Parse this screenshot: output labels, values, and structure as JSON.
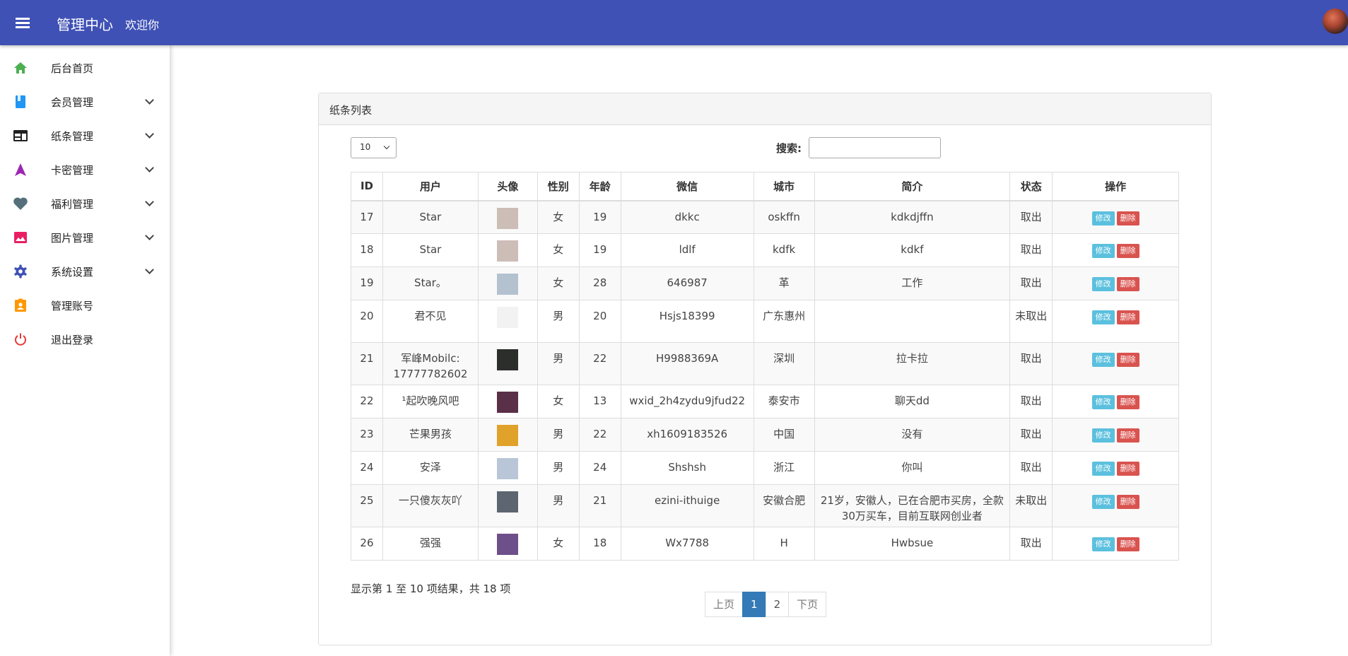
{
  "header": {
    "title": "管理中心",
    "welcome": "欢迎你"
  },
  "sidebar": {
    "items": [
      {
        "label": "后台首页",
        "icon": "home-icon",
        "color": "#4caf50"
      },
      {
        "label": "会员管理",
        "icon": "book-icon",
        "color": "#2196f3"
      },
      {
        "label": "纸条管理",
        "icon": "web-icon",
        "color": "#212121"
      },
      {
        "label": "卡密管理",
        "icon": "navigation-icon",
        "color": "#9c27b0"
      },
      {
        "label": "福利管理",
        "icon": "heart-icon",
        "color": "#546e7a"
      },
      {
        "label": "图片管理",
        "icon": "image-icon",
        "color": "#e91e63"
      },
      {
        "label": "系统设置",
        "icon": "gear-icon",
        "color": "#3f51b5"
      },
      {
        "label": "管理账号",
        "icon": "account-badge-icon",
        "color": "#ff9800"
      },
      {
        "label": "退出登录",
        "icon": "power-icon",
        "color": "#e53935"
      }
    ]
  },
  "panel": {
    "title": "纸条列表"
  },
  "controls": {
    "page_length": "10",
    "search_label": "搜索:"
  },
  "table": {
    "headers": [
      "ID",
      "用户",
      "头像",
      "性别",
      "年龄",
      "微信",
      "城市",
      "简介",
      "状态",
      "操作"
    ],
    "edit_label": "修改",
    "delete_label": "删除",
    "rows": [
      {
        "id": "17",
        "user": "Star",
        "avatar": "#cdbdb7",
        "gender": "女",
        "age": "19",
        "wechat": "dkkc",
        "city": "oskffn",
        "intro": "kdkdjffn",
        "status": "取出"
      },
      {
        "id": "18",
        "user": "Star",
        "avatar": "#cdbdb7",
        "gender": "女",
        "age": "19",
        "wechat": "ldlf",
        "city": "kdfk",
        "intro": "kdkf",
        "status": "取出"
      },
      {
        "id": "19",
        "user": "Star。",
        "avatar": "#b4c2cf",
        "gender": "女",
        "age": "28",
        "wechat": "646987",
        "city": "革",
        "intro": "工作",
        "status": "取出"
      },
      {
        "id": "20",
        "user": "君不见",
        "avatar": "#f2f2f2",
        "gender": "男",
        "age": "20",
        "wechat": "Hsjs18399",
        "city": "广东惠州",
        "intro": "",
        "status": "未取出"
      },
      {
        "id": "21",
        "user": "军峰Mobilc: 17777782602",
        "avatar": "#2c2e2c",
        "gender": "男",
        "age": "22",
        "wechat": "H9988369A",
        "city": "深圳",
        "intro": "拉卡拉",
        "status": "取出"
      },
      {
        "id": "22",
        "user": "¹起吹晚风吧",
        "avatar": "#5a2f48",
        "gender": "女",
        "age": "13",
        "wechat": "wxid_2h4zydu9jfud22",
        "city": "泰安市",
        "intro": "聊天dd",
        "status": "取出"
      },
      {
        "id": "23",
        "user": "芒果男孩",
        "avatar": "#e0a22a",
        "gender": "男",
        "age": "22",
        "wechat": "xh1609183526",
        "city": "中国",
        "intro": "没有",
        "status": "取出"
      },
      {
        "id": "24",
        "user": "安泽",
        "avatar": "#b8c6d8",
        "gender": "男",
        "age": "24",
        "wechat": "Shshsh",
        "city": "浙江",
        "intro": "你叫",
        "status": "取出"
      },
      {
        "id": "25",
        "user": "一只傻灰灰吖",
        "avatar": "#5c6570",
        "gender": "男",
        "age": "21",
        "wechat": "ezini-ithuige",
        "city": "安徽合肥",
        "intro": "21岁，安徽人，已在合肥市买房，全款30万买车，目前互联网创业者",
        "status": "未取出"
      },
      {
        "id": "26",
        "user": "强强",
        "avatar": "#6d4f8a",
        "gender": "女",
        "age": "18",
        "wechat": "Wx7788",
        "city": "H",
        "intro": "Hwbsue",
        "status": "取出"
      }
    ]
  },
  "footer": {
    "info": "显示第 1 至 10 项结果，共 18 项",
    "prev": "上页",
    "pages": [
      "1",
      "2"
    ],
    "current_page": "1",
    "next": "下页"
  }
}
